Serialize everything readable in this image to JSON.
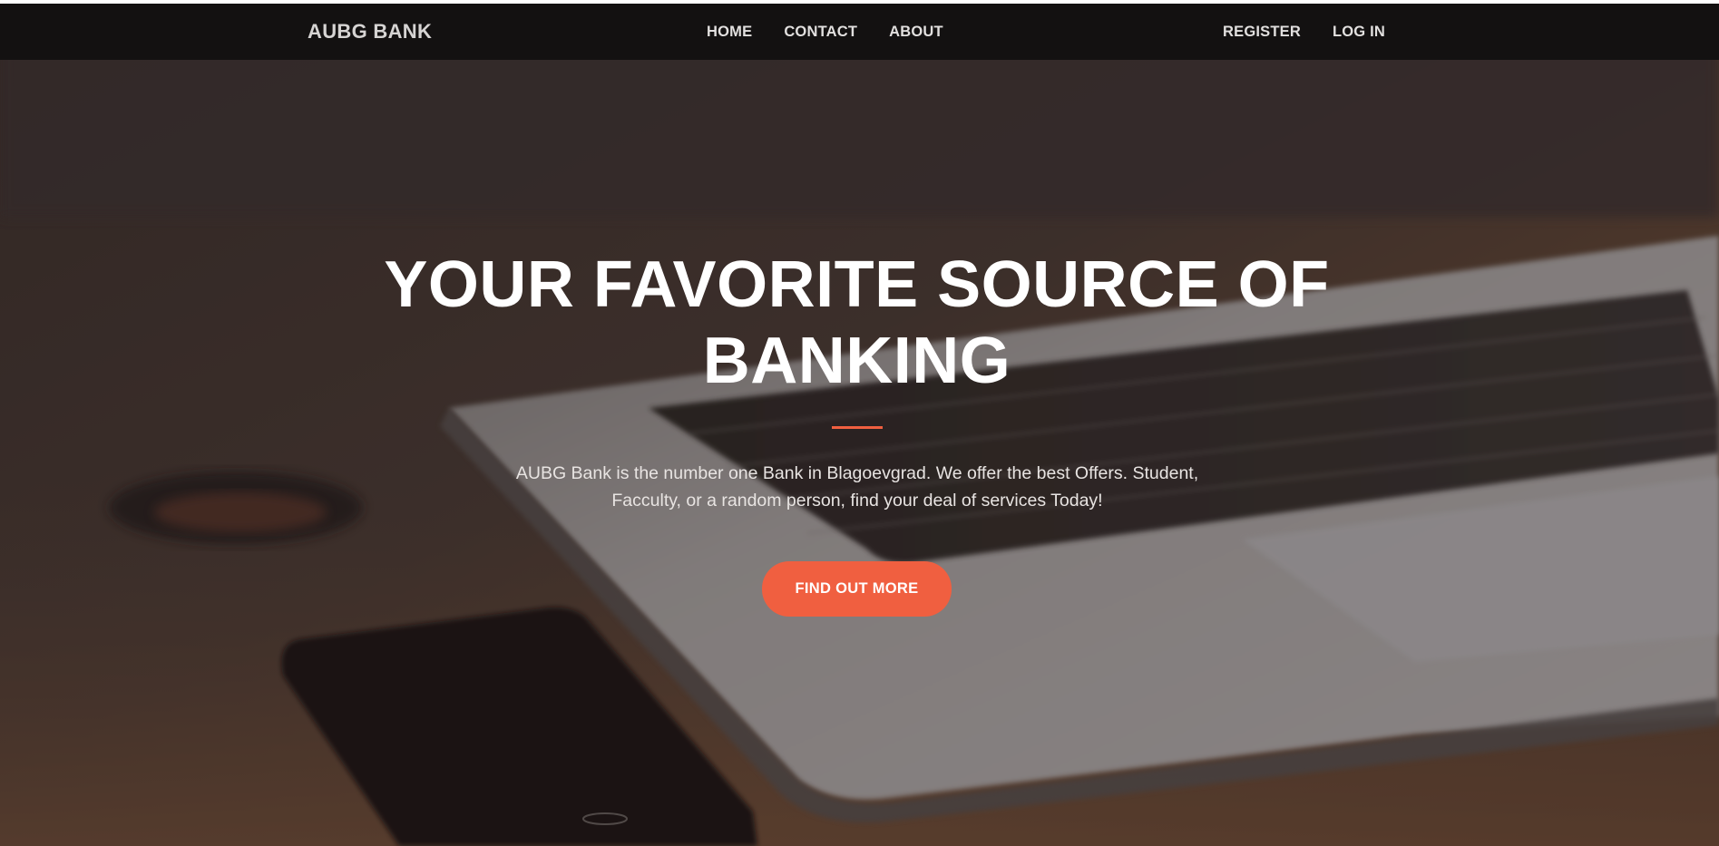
{
  "navbar": {
    "brand": "AUBG BANK",
    "links": [
      "HOME",
      "CONTACT",
      "ABOUT"
    ],
    "auth_links": [
      "REGISTER",
      "LOG IN"
    ]
  },
  "hero": {
    "heading": "YOUR FAVORITE SOURCE OF BANKING",
    "description": "AUBG Bank is the number one Bank in Blagoevgrad. We offer the best Offers. Student, Facculty, or a random person, find your deal of services Today!",
    "cta_label": "FIND OUT MORE"
  },
  "colors": {
    "accent": "#f05f40",
    "navbar": "#131111",
    "heading": "#ffffff"
  }
}
